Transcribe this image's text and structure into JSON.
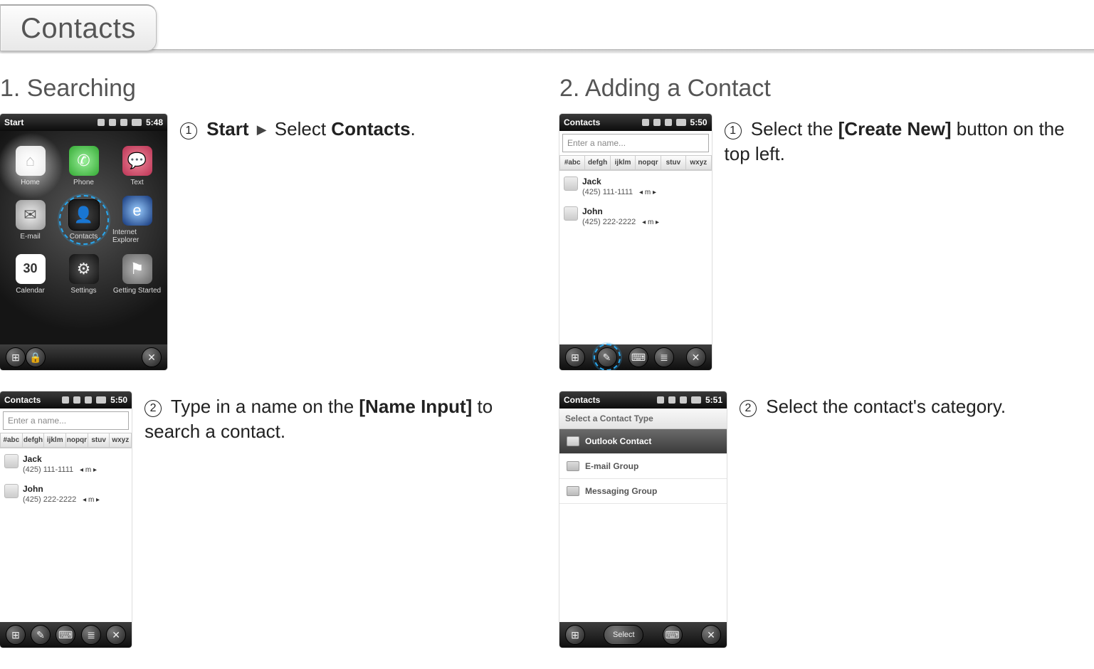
{
  "tab": {
    "label": "Contacts"
  },
  "sections": {
    "searching": {
      "heading": "1. Searching"
    },
    "adding": {
      "heading": "2. Adding a Contact"
    }
  },
  "steps": {
    "s1a": {
      "pre": "Start",
      "sep": "▶",
      "mid": " Select ",
      "post": "Contacts",
      "tail": "."
    },
    "s1b": {
      "pre": "Type in a name on the ",
      "b": "[Name Input]",
      "post": " to search a contact."
    },
    "s2a": {
      "pre": "Select the ",
      "b": "[Create New]",
      "post": " button on the top left."
    },
    "s2b": {
      "text": "Select the contact's category."
    }
  },
  "phone": {
    "start": {
      "title": "Start",
      "time": "5:48",
      "apps": {
        "home": "Home",
        "phone": "Phone",
        "text": "Text",
        "email": "E-mail",
        "contacts": "Contacts",
        "ie": "Internet Explorer",
        "calendar": "Calendar",
        "settings": "Settings",
        "gs": "Getting Started",
        "cal_day": "30"
      }
    },
    "contacts": {
      "title": "Contacts",
      "time": "5:50",
      "placeholder": "Enter a name...",
      "tabs": [
        "#abc",
        "defgh",
        "ijklm",
        "nopqr",
        "stuv",
        "wxyz"
      ],
      "items": [
        {
          "name": "Jack",
          "num": "(425) 111-1111",
          "type": "m"
        },
        {
          "name": "John",
          "num": "(425) 222-2222",
          "type": "m"
        }
      ]
    },
    "select": {
      "title": "Contacts",
      "time": "5:51",
      "header": "Select a Contact Type",
      "options": [
        "Outlook Contact",
        "E-mail Group",
        "Messaging Group"
      ],
      "button": "Select"
    }
  }
}
